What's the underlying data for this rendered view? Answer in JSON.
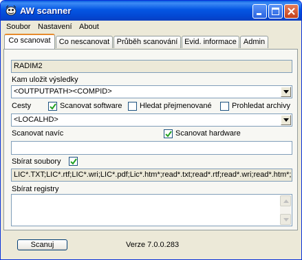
{
  "window": {
    "title": "AW scanner"
  },
  "menu": {
    "items": [
      {
        "label": "Soubor"
      },
      {
        "label": "Nastavení"
      },
      {
        "label": "About"
      }
    ]
  },
  "tabs": [
    {
      "label": "Co scanovat"
    },
    {
      "label": "Co nescanovat"
    },
    {
      "label": "Průběh scanování"
    },
    {
      "label": "Evid. informace"
    },
    {
      "label": "Admin"
    }
  ],
  "form": {
    "computer_name": "RADIM2",
    "save_label": "Kam uložit výsledky",
    "save_value": "<OUTPUTPATH><COMPID>",
    "paths_label": "Cesty",
    "scan_software": {
      "label": "Scanovat software",
      "checked": true
    },
    "find_renamed": {
      "label": "Hledat přejmenované",
      "checked": false
    },
    "search_archives": {
      "label": "Prohledat archivy",
      "checked": false
    },
    "paths_value": "<LOCALHD>",
    "scan_extra_label": "Scanovat navíc",
    "scan_extra_value": "",
    "scan_hardware": {
      "label": "Scanovat hardware",
      "checked": true
    },
    "collect_files": {
      "label": "Sbírat soubory",
      "checked": true
    },
    "files_pattern": "LIC*.TXT;LIC*.rtf;LIC*.wri;LIC*.pdf;Lic*.htm*;read*.txt;read*.rtf;read*.wri;read*.htm*;rea",
    "registry_label": "Sbírat registry",
    "registry_value": ""
  },
  "footer": {
    "scan_button": "Scanuj",
    "version": "Verze 7.0.0.283"
  }
}
